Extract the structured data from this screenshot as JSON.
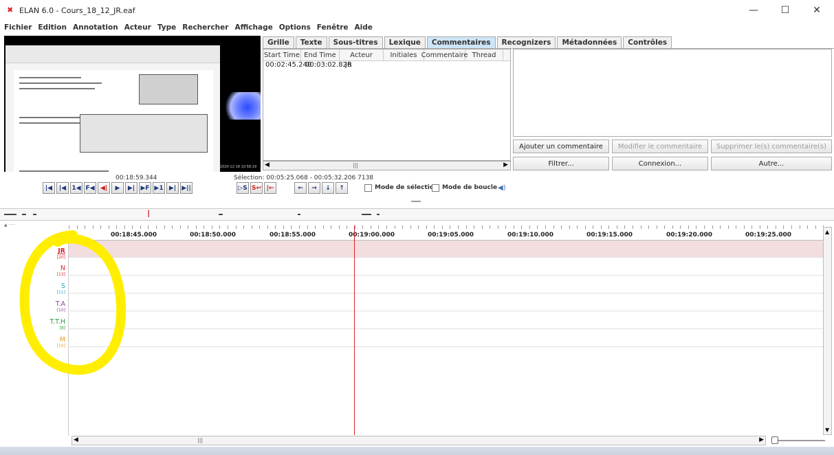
{
  "window": {
    "title": "ELAN 6.0 - Cours_18_12_JR.eaf",
    "app_icon": "elan-x-icon",
    "controls": {
      "minimize": "—",
      "maximize": "☐",
      "close": "✕"
    }
  },
  "menubar": [
    "Fichier",
    "Edition",
    "Annotation",
    "Acteur",
    "Type",
    "Rechercher",
    "Affichage",
    "Options",
    "Fenêtre",
    "Aide"
  ],
  "tabs": [
    {
      "label": "Grille",
      "active": false
    },
    {
      "label": "Texte",
      "active": false
    },
    {
      "label": "Sous-titres",
      "active": false
    },
    {
      "label": "Lexique",
      "active": false
    },
    {
      "label": "Commentaires",
      "active": true
    },
    {
      "label": "Recognizers",
      "active": false
    },
    {
      "label": "Métadonnées",
      "active": false
    },
    {
      "label": "Contrôles",
      "active": false
    }
  ],
  "comments_table": {
    "columns": [
      "Start Time",
      "End Time",
      "Acteur",
      "Initiales",
      "Commentaire",
      "Thread"
    ],
    "rows": [
      [
        "00:02:45.240",
        "00:03:02.826",
        "JR",
        "",
        "",
        ""
      ]
    ]
  },
  "comment_buttons": {
    "add": "Ajouter un commentaire",
    "modify": "Modifier le commentaire",
    "delete": "Supprimer le(s) commentaire(s)",
    "filter": "Filtrer...",
    "connect": "Connexion...",
    "other": "Autre..."
  },
  "media": {
    "current_time": "00:18:59.344",
    "selection": "Sélection: 00:05:25.068 - 00:05:32.206  7138",
    "controls": [
      "|◀",
      "|◀",
      "1◀",
      "F◀",
      "◀|",
      "▶",
      "▶|",
      "▶F",
      "▶1",
      "▶|",
      "▶||"
    ],
    "selection_controls": [
      "▷S",
      "S↩",
      "|←"
    ],
    "nav_controls": [
      "←",
      "→",
      "↓",
      "↑"
    ],
    "selection_mode_label": "Mode de sélection",
    "loop_mode_label": "Mode de boucle"
  },
  "timeline": {
    "ruler_labels": [
      "00:18:45.000",
      "00:18:50.000",
      "00:18:55.000",
      "00:19:00.000",
      "00:19:05.000",
      "00:19:10.000",
      "00:19:15.000",
      "00:19:20.000",
      "00:19:25.000"
    ],
    "tiers": [
      {
        "name": "JR",
        "count": "[20]",
        "color": "#d7262e"
      },
      {
        "name": "N",
        "count": "[13]",
        "color": "#d7262e"
      },
      {
        "name": "S",
        "count": "[11]",
        "color": "#27a3b8"
      },
      {
        "name": "T.A",
        "count": "[10]",
        "color": "#9a3aa8"
      },
      {
        "name": "T.T.H",
        "count": "[8]",
        "color": "#2f9a38"
      },
      {
        "name": "M",
        "count": "[10]",
        "color": "#e39b20"
      }
    ],
    "active_tier_color": "#f2dede",
    "crosshair_color": "#e0202a"
  },
  "video": {
    "timestamp": "2020-12-18 10:58:19"
  },
  "annotation_color": "#ffee00"
}
